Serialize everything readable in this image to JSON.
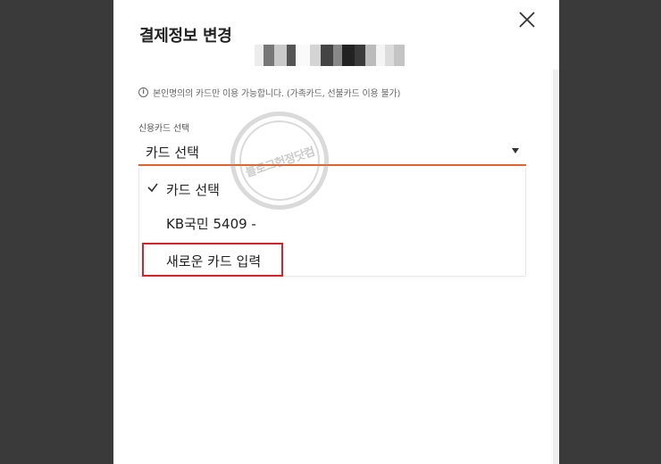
{
  "modal": {
    "title": "결제정보 변경",
    "notice": "본인명의의 카드만 이용 가능합니다. (가족카드, 선불카드 이용 불가)",
    "card_select": {
      "label": "신용카드 선택",
      "selected_value": "카드 선택",
      "options": [
        {
          "label": "카드 선택",
          "checked": true
        },
        {
          "label": "KB국민 5409 -",
          "masked": true
        },
        {
          "label": "새로운 카드 입력",
          "highlighted": true
        }
      ]
    }
  },
  "watermark": {
    "text": "블로그헌정닷컴"
  },
  "colors": {
    "accent_underline": "#e5622a",
    "highlight_border": "#d8232a",
    "backdrop": "#3a3a3a"
  },
  "icons": {
    "close": "close-icon",
    "info": "info-icon",
    "check": "check-icon",
    "dropdown_arrow": "caret-down-icon"
  }
}
